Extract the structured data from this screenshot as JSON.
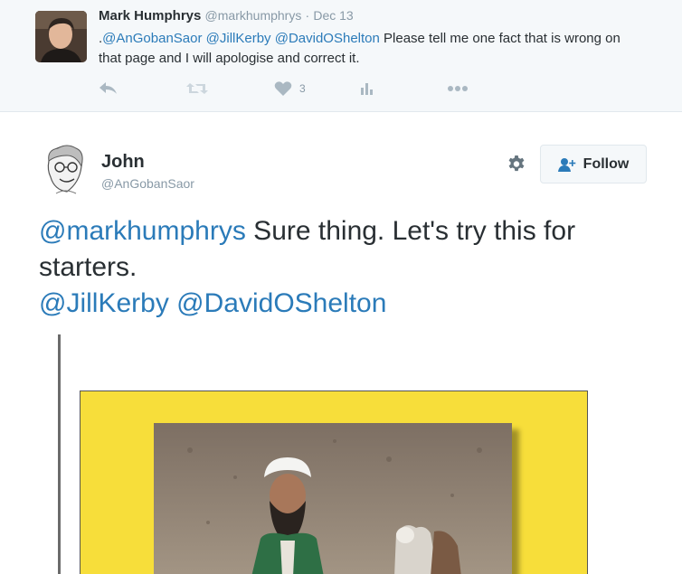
{
  "parent_tweet": {
    "name": "Mark Humphrys",
    "handle": "@markhumphrys",
    "dot": "·",
    "date": "Dec 13",
    "text_prefix": ".",
    "mentions": [
      "@AnGobanSaor",
      "@JillKerby",
      "@DavidOShelton"
    ],
    "text_body": " Please tell me one fact that is wrong on that page and I will apologise and correct it.",
    "like_count": "3",
    "icons": [
      "reply-icon",
      "retweet-icon",
      "heart-icon",
      "analytics-icon",
      "more-icon"
    ]
  },
  "main_tweet": {
    "name": "John",
    "handle": "@AnGobanSaor",
    "follow_label": "Follow",
    "text_mention_1": "@markhumphrys",
    "text_body": " Sure thing. Let's try this for starters.",
    "mentions": [
      "@JillKerby",
      "@DavidOShelton"
    ],
    "icons": [
      "gear-icon",
      "follow-person-icon"
    ]
  },
  "colors": {
    "link": "#2b7bb9",
    "parent_background": "#f5f8fa",
    "photo_frame": "#f7de3a"
  }
}
